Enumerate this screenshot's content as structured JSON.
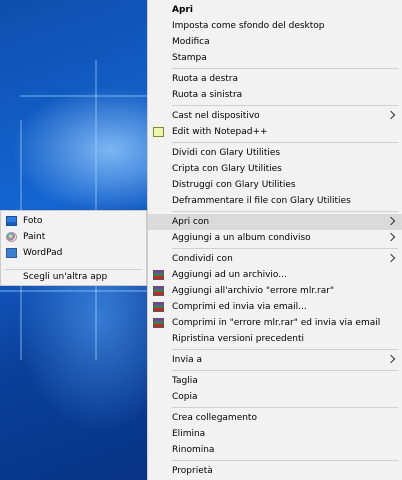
{
  "context_menu": {
    "items": [
      {
        "label": "Apri"
      },
      {
        "label": "Imposta come sfondo del desktop"
      },
      {
        "label": "Modifica"
      },
      {
        "label": "Stampa"
      },
      {
        "label": "Ruota a destra"
      },
      {
        "label": "Ruota a sinistra"
      },
      {
        "label": "Cast nel dispositivo"
      },
      {
        "label": "Edit with Notepad++"
      },
      {
        "label": "Dividi con Glary Utilities"
      },
      {
        "label": "Cripta con Glary Utilities"
      },
      {
        "label": "Distruggi con Glary Utilities"
      },
      {
        "label": "Deframmentare il file con Glary Utilities"
      },
      {
        "label": "Apri con"
      },
      {
        "label": "Aggiungi a un album condiviso"
      },
      {
        "label": "Condividi con"
      },
      {
        "label": "Aggiungi ad un archivio..."
      },
      {
        "label": "Aggiungi all'archivio \"errore mlr.rar\""
      },
      {
        "label": "Comprimi ed invia via email..."
      },
      {
        "label": "Comprimi in \"errore mlr.rar\" ed invia via email"
      },
      {
        "label": "Ripristina versioni precedenti"
      },
      {
        "label": "Invia a"
      },
      {
        "label": "Taglia"
      },
      {
        "label": "Copia"
      },
      {
        "label": "Crea collegamento"
      },
      {
        "label": "Elimina"
      },
      {
        "label": "Rinomina"
      },
      {
        "label": "Proprietà"
      }
    ]
  },
  "open_with_submenu": {
    "items": [
      {
        "label": "Foto",
        "icon": "photos-icon"
      },
      {
        "label": "Paint",
        "icon": "paint-icon"
      },
      {
        "label": "WordPad",
        "icon": "wordpad-icon"
      },
      {
        "label": "Scegli un'altra app"
      }
    ]
  }
}
